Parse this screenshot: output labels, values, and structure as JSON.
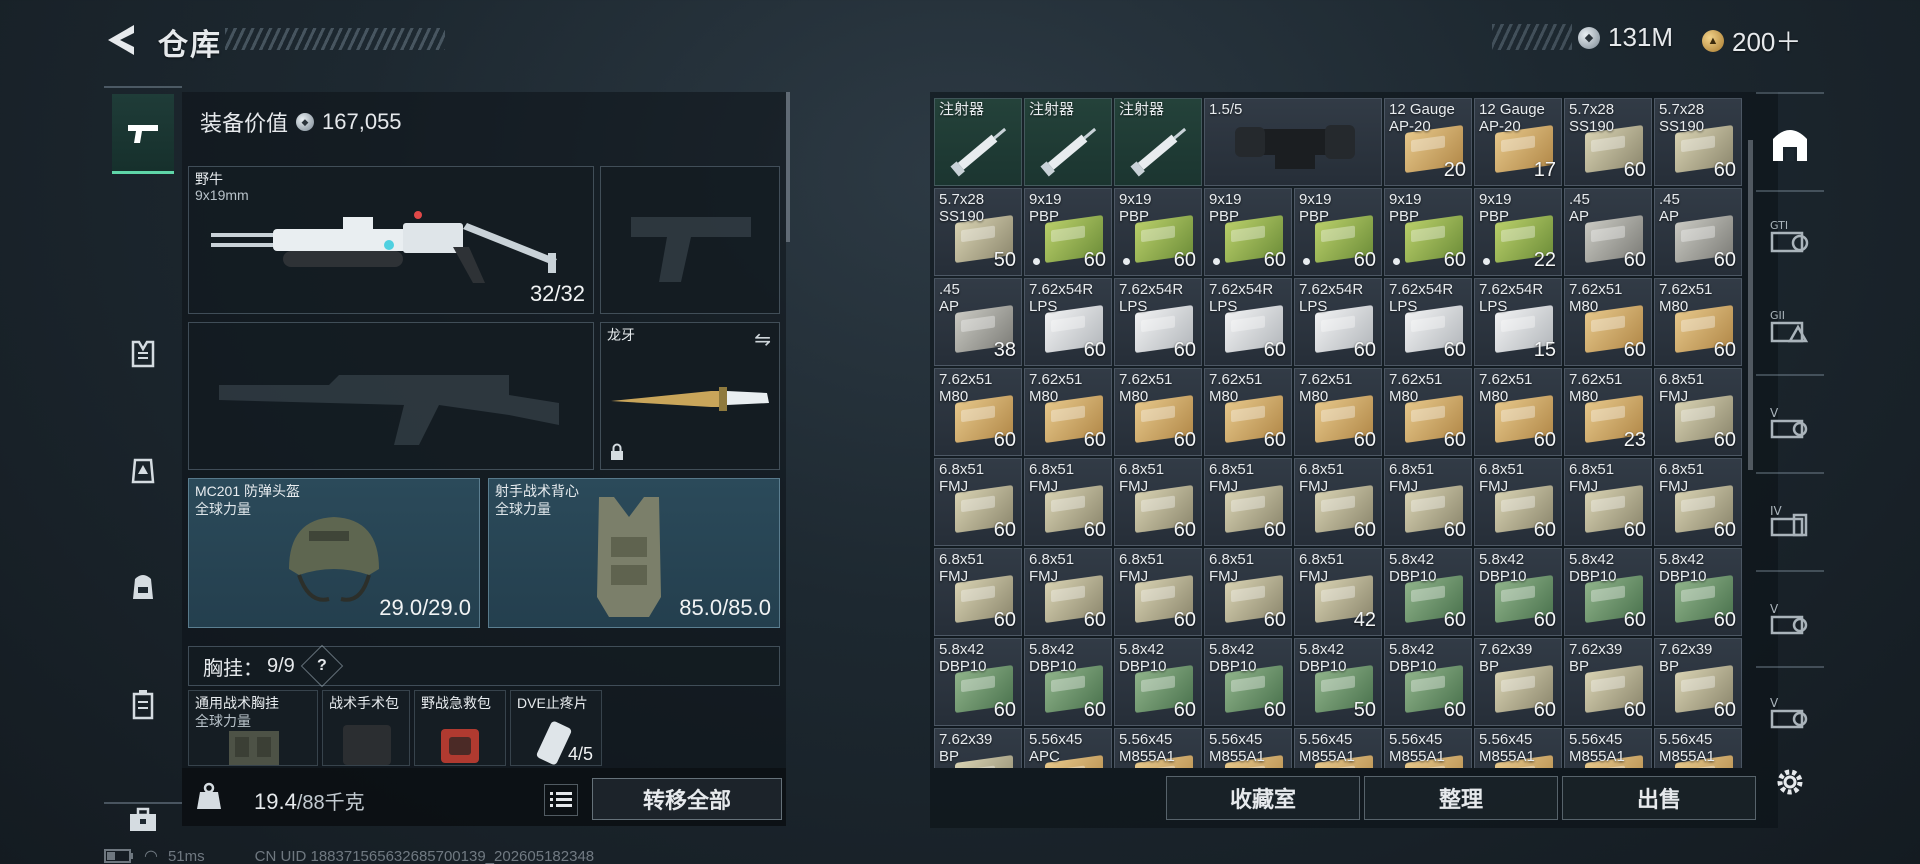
{
  "header": {
    "title": "仓库",
    "currency_silver": "131M",
    "currency_gold": "200＋"
  },
  "category_tabs": [
    "gun-icon",
    "vest-icon",
    "rig-icon",
    "backpack-icon",
    "pouch-icon",
    "case-icon"
  ],
  "equipment": {
    "value_label": "装备价值",
    "value": "167,055",
    "primary": {
      "name": "野牛",
      "caliber": "9x19mm",
      "ammo": "32/32"
    },
    "knife": {
      "name": "龙牙"
    },
    "helmet": {
      "name": "MC201 防弹头盔",
      "brand": "全球力量",
      "durability": "29.0/29.0"
    },
    "armor": {
      "name": "射手战术背心",
      "brand": "全球力量",
      "durability": "85.0/85.0"
    },
    "rig_label": "胸挂：",
    "rig_count": "9/9",
    "rig_help": "?",
    "rig_items": [
      {
        "name": "通用战术胸挂",
        "sub": "全球力量"
      },
      {
        "name": "战术手术包",
        "sub": ""
      },
      {
        "name": "野战急救包",
        "sub": ""
      },
      {
        "name": "DVE止疼片",
        "sub": "",
        "count": "4/5"
      }
    ],
    "weight_current": "19.4",
    "weight_max": "/88千克",
    "transfer_label": "转移全部"
  },
  "stash": {
    "rows": [
      [
        {
          "name": "注射器",
          "qty": "",
          "type": "syringe",
          "green": true
        },
        {
          "name": "注射器",
          "qty": "",
          "type": "syringe",
          "green": true
        },
        {
          "name": "注射器",
          "qty": "",
          "type": "syringe",
          "green": true
        },
        {
          "name": "1.5/5",
          "qty": "",
          "type": "scope",
          "wide": true
        },
        {
          "name": "12 Gauge\nAP-20",
          "qty": "20",
          "type": "gold"
        },
        {
          "name": "12 Gauge\nAP-20",
          "qty": "17",
          "type": "gold"
        },
        {
          "name": "5.7x28\nSS190",
          "qty": "60",
          "type": "olive"
        },
        {
          "name": "5.7x28\nSS190",
          "qty": "60",
          "type": "olive"
        }
      ],
      [
        {
          "name": "5.7x28\nSS190",
          "qty": "50",
          "type": "olive"
        },
        {
          "name": "9x19\nPBP",
          "qty": "60",
          "type": "green",
          "dot": true
        },
        {
          "name": "9x19\nPBP",
          "qty": "60",
          "type": "green",
          "dot": true
        },
        {
          "name": "9x19\nPBP",
          "qty": "60",
          "type": "green",
          "dot": true
        },
        {
          "name": "9x19\nPBP",
          "qty": "60",
          "type": "green",
          "dot": true
        },
        {
          "name": "9x19\nPBP",
          "qty": "60",
          "type": "green",
          "dot": true
        },
        {
          "name": "9x19\nPBP",
          "qty": "22",
          "type": "green",
          "dot": true
        },
        {
          "name": ".45\nAP",
          "qty": "60",
          "type": "grey"
        },
        {
          "name": ".45\nAP",
          "qty": "60",
          "type": "grey"
        }
      ],
      [
        {
          "name": ".45\nAP",
          "qty": "38",
          "type": "grey"
        },
        {
          "name": "7.62x54R\nLPS",
          "qty": "60",
          "type": "white"
        },
        {
          "name": "7.62x54R\nLPS",
          "qty": "60",
          "type": "white"
        },
        {
          "name": "7.62x54R\nLPS",
          "qty": "60",
          "type": "white"
        },
        {
          "name": "7.62x54R\nLPS",
          "qty": "60",
          "type": "white"
        },
        {
          "name": "7.62x54R\nLPS",
          "qty": "60",
          "type": "white"
        },
        {
          "name": "7.62x54R\nLPS",
          "qty": "15",
          "type": "white"
        },
        {
          "name": "7.62x51\nM80",
          "qty": "60",
          "type": "gold"
        },
        {
          "name": "7.62x51\nM80",
          "qty": "60",
          "type": "gold"
        }
      ],
      [
        {
          "name": "7.62x51\nM80",
          "qty": "60",
          "type": "gold"
        },
        {
          "name": "7.62x51\nM80",
          "qty": "60",
          "type": "gold"
        },
        {
          "name": "7.62x51\nM80",
          "qty": "60",
          "type": "gold"
        },
        {
          "name": "7.62x51\nM80",
          "qty": "60",
          "type": "gold"
        },
        {
          "name": "7.62x51\nM80",
          "qty": "60",
          "type": "gold"
        },
        {
          "name": "7.62x51\nM80",
          "qty": "60",
          "type": "gold"
        },
        {
          "name": "7.62x51\nM80",
          "qty": "60",
          "type": "gold"
        },
        {
          "name": "7.62x51\nM80",
          "qty": "23",
          "type": "gold"
        },
        {
          "name": "6.8x51\nFMJ",
          "qty": "60",
          "type": "olive"
        }
      ],
      [
        {
          "name": "6.8x51\nFMJ",
          "qty": "60",
          "type": "olive"
        },
        {
          "name": "6.8x51\nFMJ",
          "qty": "60",
          "type": "olive"
        },
        {
          "name": "6.8x51\nFMJ",
          "qty": "60",
          "type": "olive"
        },
        {
          "name": "6.8x51\nFMJ",
          "qty": "60",
          "type": "olive"
        },
        {
          "name": "6.8x51\nFMJ",
          "qty": "60",
          "type": "olive"
        },
        {
          "name": "6.8x51\nFMJ",
          "qty": "60",
          "type": "olive"
        },
        {
          "name": "6.8x51\nFMJ",
          "qty": "60",
          "type": "olive"
        },
        {
          "name": "6.8x51\nFMJ",
          "qty": "60",
          "type": "olive"
        },
        {
          "name": "6.8x51\nFMJ",
          "qty": "60",
          "type": "olive"
        }
      ],
      [
        {
          "name": "6.8x51\nFMJ",
          "qty": "60",
          "type": "olive"
        },
        {
          "name": "6.8x51\nFMJ",
          "qty": "60",
          "type": "olive"
        },
        {
          "name": "6.8x51\nFMJ",
          "qty": "60",
          "type": "olive"
        },
        {
          "name": "6.8x51\nFMJ",
          "qty": "60",
          "type": "olive"
        },
        {
          "name": "6.8x51\nFMJ",
          "qty": "42",
          "type": "olive"
        },
        {
          "name": "5.8x42\nDBP10",
          "qty": "60",
          "type": "dgreen"
        },
        {
          "name": "5.8x42\nDBP10",
          "qty": "60",
          "type": "dgreen"
        },
        {
          "name": "5.8x42\nDBP10",
          "qty": "60",
          "type": "dgreen"
        },
        {
          "name": "5.8x42\nDBP10",
          "qty": "60",
          "type": "dgreen"
        }
      ],
      [
        {
          "name": "5.8x42\nDBP10",
          "qty": "60",
          "type": "dgreen"
        },
        {
          "name": "5.8x42\nDBP10",
          "qty": "60",
          "type": "dgreen"
        },
        {
          "name": "5.8x42\nDBP10",
          "qty": "60",
          "type": "dgreen"
        },
        {
          "name": "5.8x42\nDBP10",
          "qty": "60",
          "type": "dgreen"
        },
        {
          "name": "5.8x42\nDBP10",
          "qty": "50",
          "type": "dgreen"
        },
        {
          "name": "5.8x42\nDBP10",
          "qty": "60",
          "type": "dgreen"
        },
        {
          "name": "7.62x39\nBP",
          "qty": "60",
          "type": "olive"
        },
        {
          "name": "7.62x39\nBP",
          "qty": "60",
          "type": "olive"
        },
        {
          "name": "7.62x39\nBP",
          "qty": "60",
          "type": "olive"
        }
      ],
      [
        {
          "name": "7.62x39\nBP",
          "qty": "",
          "type": "olive"
        },
        {
          "name": "5.56x45\nAPC",
          "qty": "",
          "type": "gold"
        },
        {
          "name": "5.56x45\nM855A1",
          "qty": "",
          "type": "gold"
        },
        {
          "name": "5.56x45\nM855A1",
          "qty": "",
          "type": "gold"
        },
        {
          "name": "5.56x45\nM855A1",
          "qty": "",
          "type": "gold"
        },
        {
          "name": "5.56x45\nM855A1",
          "qty": "",
          "type": "gold"
        },
        {
          "name": "5.56x45\nM855A1",
          "qty": "",
          "type": "gold"
        },
        {
          "name": "5.56x45\nM855A1",
          "qty": "",
          "type": "gold"
        },
        {
          "name": "5.56x45\nM855A1",
          "qty": "",
          "type": "gold"
        }
      ]
    ],
    "buttons": [
      "收藏室",
      "整理",
      "出售"
    ]
  },
  "right_rail": [
    "stash-icon",
    "gti-icon",
    "gii-icon",
    "case-v-icon",
    "case-iv-icon",
    "case-v2-icon",
    "case-v3-icon",
    "settings-icon"
  ],
  "status": {
    "ping": "51ms",
    "uid": "CN UID 1883715656326857001​39_202605182348"
  },
  "colors": {
    "accent": "#5fd6a8",
    "panel": "#262e38",
    "slot_blue": "#2b4a5a"
  }
}
